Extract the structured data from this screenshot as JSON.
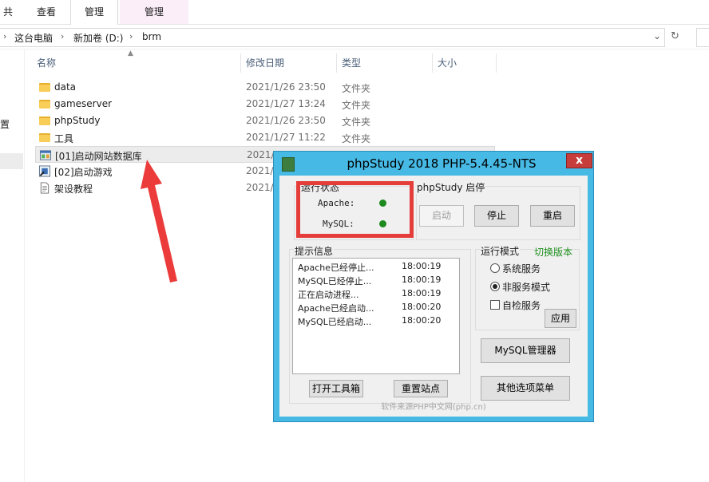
{
  "ribbon": {
    "tabs": [
      "共享",
      "查看",
      "管理",
      "管理"
    ]
  },
  "address": {
    "crumbs": [
      "这台电脑",
      "新加卷 (D:)",
      "brm"
    ]
  },
  "nav_stub": [
    "置"
  ],
  "columns": {
    "name": "名称",
    "date": "修改日期",
    "type": "类型",
    "size": "大小"
  },
  "files": [
    {
      "name": "data",
      "date": "2021/1/26 23:50",
      "type": "文件夹"
    },
    {
      "name": "gameserver",
      "date": "2021/1/27 13:24",
      "type": "文件夹"
    },
    {
      "name": "phpStudy",
      "date": "2021/1/26 23:50",
      "type": "文件夹"
    },
    {
      "name": "工具",
      "date": "2021/1/27 11:22",
      "type": "文件夹"
    },
    {
      "name": "[01]启动网站数据库",
      "date": "2021/"
    },
    {
      "name": "[02]启动游戏",
      "date": "2021/"
    },
    {
      "name": "架设教程",
      "date": "2021/"
    }
  ],
  "phpstudy": {
    "title": "phpStudy 2018   PHP-5.4.45-NTS",
    "close": "x",
    "status_group": "运行状态",
    "apache_label": "Apache:",
    "mysql_label": "MySQL:",
    "control_group": "phpStudy 启停",
    "start": "启动",
    "stop": "停止",
    "restart": "重启",
    "log_group": "提示信息",
    "log": [
      {
        "msg": "Apache已经停止...",
        "time": "18:00:19"
      },
      {
        "msg": "MySQL已经停止...",
        "time": "18:00:19"
      },
      {
        "msg": "正在启动进程...",
        "time": "18:00:19"
      },
      {
        "msg": "Apache已经启动...",
        "time": "18:00:20"
      },
      {
        "msg": "MySQL已经启动...",
        "time": "18:00:20"
      }
    ],
    "mode_group": "运行模式",
    "switch_version": "切换版本",
    "mode_system": "系统服务",
    "mode_nonservice": "非服务模式",
    "self_check": "自检服务",
    "apply": "应用",
    "mysql_manager": "MySQL管理器",
    "toolbox": "打开工具箱",
    "reset_sites": "重置站点",
    "other_menu": "其他选项菜单",
    "source": "软件来源PHP中文网(php.cn)",
    "status_color": "#1d8a1d"
  }
}
